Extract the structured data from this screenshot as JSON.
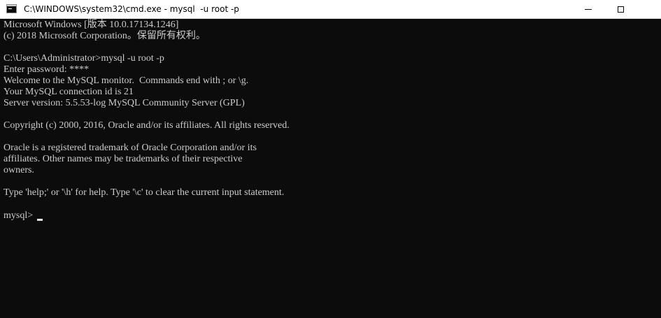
{
  "window": {
    "title": "C:\\WINDOWS\\system32\\cmd.exe - mysql  -u root -p",
    "icon": "cmd-icon",
    "controls": {
      "minimize": "minimize-icon",
      "maximize": "maximize-icon",
      "close": "close-icon"
    }
  },
  "console": {
    "background": "#0c0c0c",
    "foreground": "#cccccc",
    "lines": [
      "Microsoft Windows [版本 10.0.17134.1246]",
      "(c) 2018 Microsoft Corporation。保留所有权利。",
      "",
      "C:\\Users\\Administrator>mysql -u root -p",
      "Enter password: ****",
      "Welcome to the MySQL monitor.  Commands end with ; or \\g.",
      "Your MySQL connection id is 21",
      "Server version: 5.5.53-log MySQL Community Server (GPL)",
      "",
      "Copyright (c) 2000, 2016, Oracle and/or its affiliates. All rights reserved.",
      "",
      "Oracle is a registered trademark of Oracle Corporation and/or its",
      "affiliates. Other names may be trademarks of their respective",
      "owners.",
      "",
      "Type 'help;' or '\\h' for help. Type '\\c' to clear the current input statement.",
      ""
    ],
    "prompt": "mysql>"
  }
}
